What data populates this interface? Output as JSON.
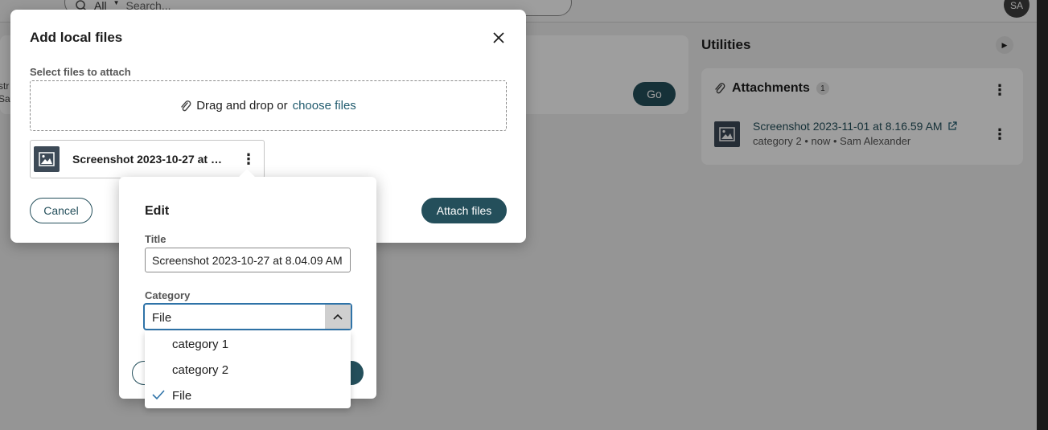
{
  "background": {
    "search": {
      "filter": "All",
      "placeholder": "Search..."
    },
    "avatar_initials": "SA",
    "left_fragment": [
      "str",
      "Sa"
    ],
    "go_label": "Go",
    "utilities": {
      "title": "Utilities",
      "attachments_label": "Attachments",
      "attachments_count": "1",
      "file": {
        "title": "Screenshot 2023-11-01 at 8.16.59 AM",
        "meta": "category 2 • now • Sam Alexander"
      }
    }
  },
  "modal": {
    "title": "Add local files",
    "section_label": "Select files to attach",
    "dropzone": {
      "prefix": "Drag and drop or",
      "link": "choose files"
    },
    "file_chip_name": "Screenshot 2023-10-27 at 8.04.09 AM",
    "cancel_label": "Cancel",
    "attach_label": "Attach files"
  },
  "edit": {
    "title": "Edit",
    "title_field_label": "Title",
    "title_value": "Screenshot 2023-10-27 at 8.04.09 AM",
    "category_label": "Category",
    "category_value": "File",
    "options": [
      {
        "label": "category 1",
        "selected": false
      },
      {
        "label": "category 2",
        "selected": false
      },
      {
        "label": "File",
        "selected": true
      }
    ]
  },
  "colors": {
    "primary": "#244f5b",
    "link": "#1f5a6d",
    "focus": "#2f73a8",
    "overlay": "rgba(0,0,0,0.38)"
  },
  "icons": [
    "search-icon",
    "caret-down-icon",
    "play-icon",
    "paperclip-icon",
    "kebab-menu-icon",
    "image-icon",
    "external-link-icon",
    "close-icon",
    "chevron-up-icon",
    "check-icon"
  ]
}
